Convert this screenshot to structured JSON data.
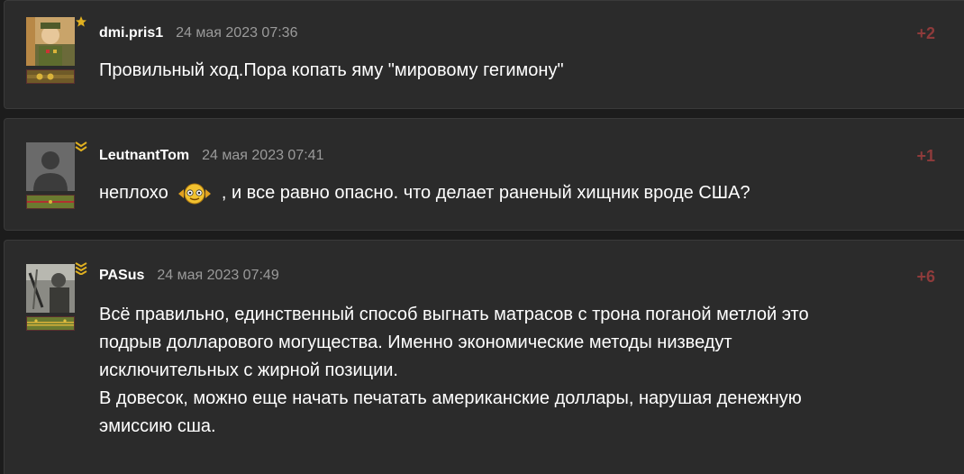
{
  "comments": [
    {
      "username": "dmi.pris1",
      "date": "24 мая 2023 07:36",
      "score": "+2",
      "text": "Провильный ход.Пора копать яму \"мировому гегимону\""
    },
    {
      "username": "LeutnantTom",
      "date": "24 мая 2023 07:41",
      "score": "+1",
      "text_before_emoji": "неплохо",
      "text_after_emoji": ", и все равно опасно. что делает раненый хищник вроде США?"
    },
    {
      "username": "PASus",
      "date": "24 мая 2023 07:49",
      "score": "+6",
      "lines": [
        "Всё правильно, единственный способ выгнать матрасов с трона поганой метлой это",
        "подрыв долларового могущества. Именно экономические методы низведут",
        "исключительных с жирной позиции.",
        "В довесок, можно еще начать печатать американские доллары, нарушая денежную",
        "эмиссию сша."
      ]
    }
  ],
  "colors": {
    "background": "#1c1c1c",
    "card": "#2b2b2b",
    "score": "#8e3b3b",
    "date": "#9a9a9a",
    "text": "#ffffff"
  },
  "icons": {
    "rank_star": "star-icon",
    "rank_chevron": "chevron-rank-icon",
    "emoji": "smiley-emoji-icon"
  }
}
